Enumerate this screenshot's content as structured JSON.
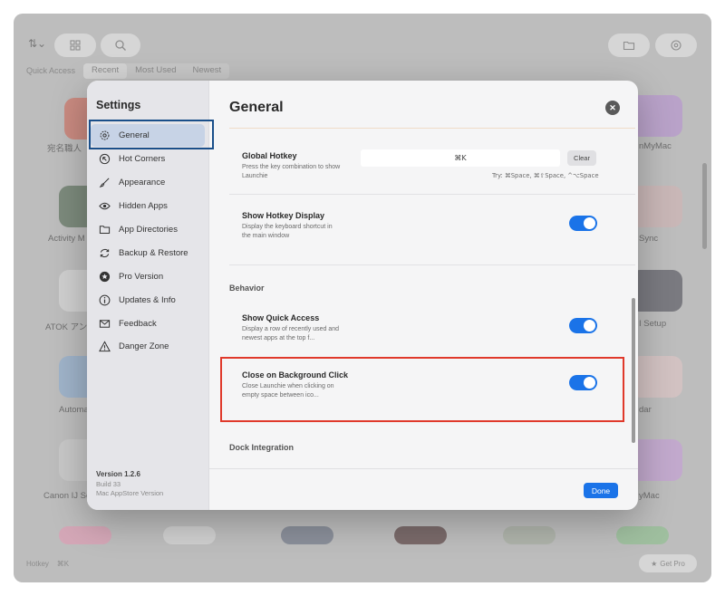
{
  "launcher": {
    "sort_label": "⇅⌄",
    "quick_access_label": "Quick Access",
    "tabs": [
      {
        "label": "Recent"
      },
      {
        "label": "Most Used"
      },
      {
        "label": "Newest"
      }
    ],
    "app_names": [
      "宛名職人",
      "Activity M",
      "ATOK アン",
      "Automa",
      "Canon IJ Sc",
      "nMyMac",
      "Sync",
      "I Setup",
      "dar",
      "yMac"
    ],
    "bottom_hotkey_label": "Hotkey",
    "bottom_hotkey_value": "⌘K",
    "get_pro_label": "Get Pro"
  },
  "settings": {
    "sidebar_title": "Settings",
    "sidebar_items": [
      {
        "label": "General",
        "icon": "gear-icon"
      },
      {
        "label": "Hot Corners",
        "icon": "hot-corners-icon"
      },
      {
        "label": "Appearance",
        "icon": "paintbrush-icon"
      },
      {
        "label": "Hidden Apps",
        "icon": "eye-icon"
      },
      {
        "label": "App Directories",
        "icon": "folder-icon"
      },
      {
        "label": "Backup & Restore",
        "icon": "refresh-icon"
      },
      {
        "label": "Pro Version",
        "icon": "star-badge-icon"
      },
      {
        "label": "Updates & Info",
        "icon": "info-icon"
      },
      {
        "label": "Feedback",
        "icon": "envelope-icon"
      },
      {
        "label": "Danger Zone",
        "icon": "warning-icon"
      }
    ],
    "version": "Version 1.2.6",
    "build": "Build 33",
    "edition": "Mac AppStore Version",
    "main_title": "General",
    "global_hotkey": {
      "title": "Global Hotkey",
      "desc": "Press the key combination to show Launchie",
      "value": "⌘K",
      "clear_label": "Clear",
      "hint": "Try: ⌘Space, ⌘⇧Space, ^⌥Space"
    },
    "show_hotkey_display": {
      "title": "Show Hotkey Display",
      "desc": "Display the keyboard shortcut in the main window",
      "enabled": true
    },
    "behavior_header": "Behavior",
    "show_quick_access": {
      "title": "Show Quick Access",
      "desc": "Display a row of recently used and newest apps at the top f...",
      "enabled": true
    },
    "close_on_bg_click": {
      "title": "Close on Background Click",
      "desc": "Close Launchie when clicking on empty space between ico...",
      "enabled": true
    },
    "dock_header": "Dock Integration",
    "done_label": "Done"
  },
  "colors": {
    "accent": "#1a73e8",
    "highlight_red": "#e0392b",
    "selection_outline": "#1a4f8a"
  }
}
